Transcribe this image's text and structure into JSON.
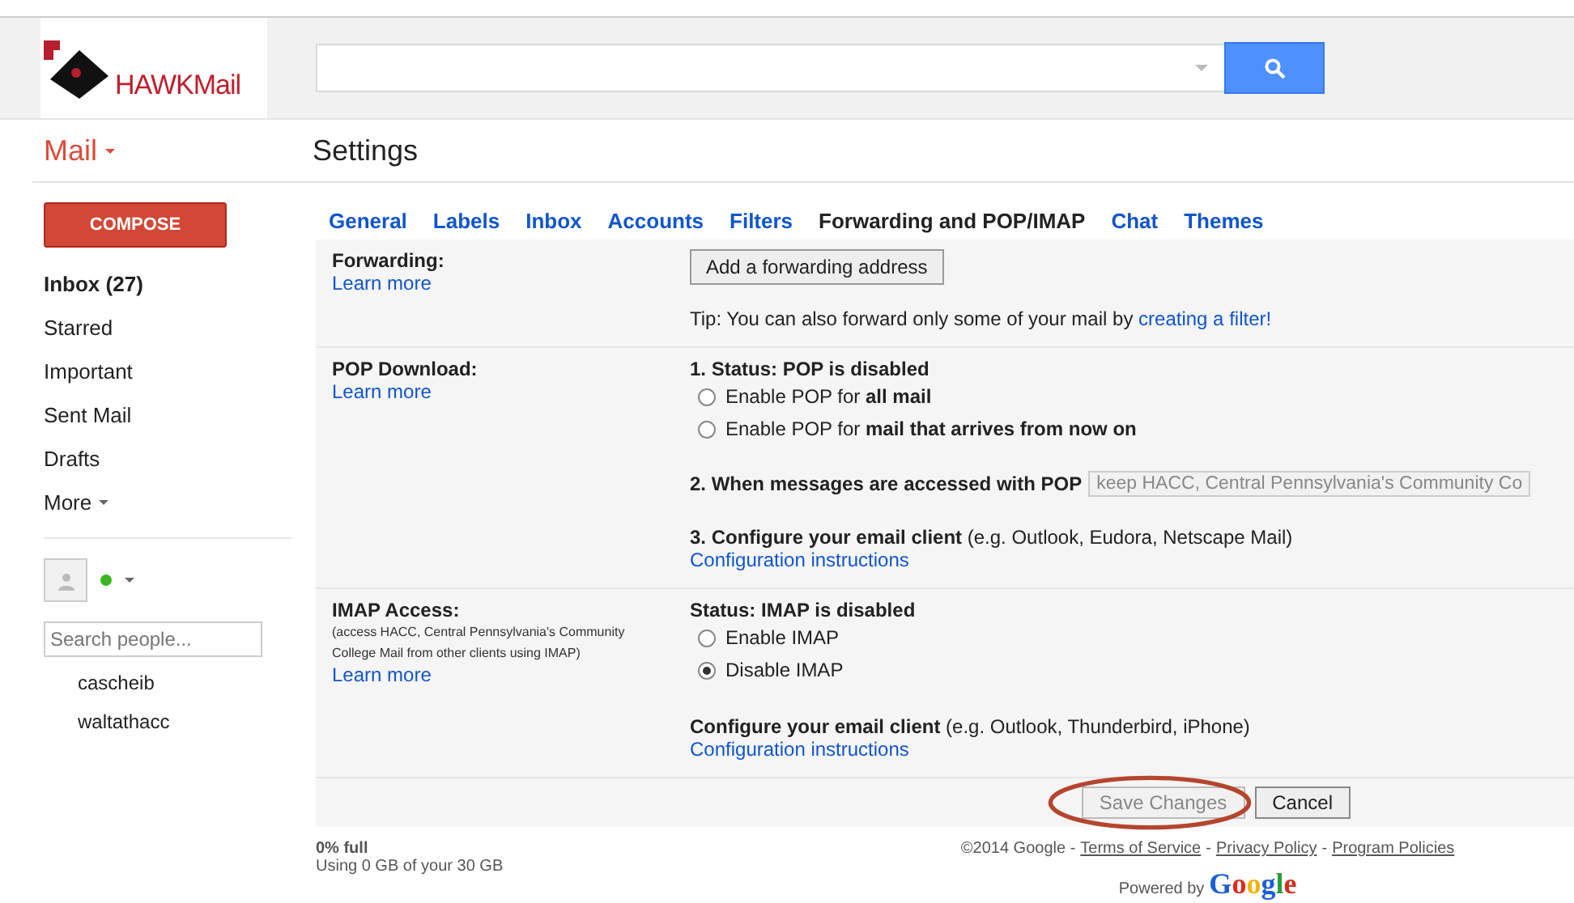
{
  "header": {
    "logo_text": "HAWKMail"
  },
  "app_switcher": "Mail",
  "page_title": "Settings",
  "compose": "COMPOSE",
  "nav": [
    {
      "label": "Inbox (27)",
      "selected": true
    },
    {
      "label": "Starred",
      "selected": false
    },
    {
      "label": "Important",
      "selected": false
    },
    {
      "label": "Sent Mail",
      "selected": false
    },
    {
      "label": "Drafts",
      "selected": false
    },
    {
      "label": "More",
      "selected": false,
      "kind": "menu"
    }
  ],
  "chat": {
    "online": true,
    "search": {
      "placeholder": "Search people..."
    },
    "contacts": [
      "cascheib",
      "waltathacc"
    ]
  },
  "tabs": [
    {
      "label": "General",
      "selected": false
    },
    {
      "label": "Labels",
      "selected": false
    },
    {
      "label": "Inbox",
      "selected": false
    },
    {
      "label": "Accounts",
      "selected": false
    },
    {
      "label": "Filters",
      "selected": false
    },
    {
      "label": "Forwarding and POP/IMAP",
      "selected": true
    },
    {
      "label": "Chat",
      "selected": false
    },
    {
      "label": "Themes",
      "selected": false
    }
  ],
  "sections": [
    {
      "title": "Forwarding:",
      "learn_more": "Learn more",
      "items": [
        {
          "kind": "button",
          "label": "Add a forwarding address"
        },
        {
          "kind": "tip",
          "text": "Tip: You can also forward only some of your mail by ",
          "link": "creating a filter!"
        }
      ]
    },
    {
      "title": "POP Download:",
      "learn_more": "Learn more",
      "items": [
        {
          "kind": "heading",
          "text": "**1. Status: POP is disabled**"
        },
        {
          "kind": "radio",
          "text": "Enable POP for **all mail**",
          "selected": false
        },
        {
          "kind": "radio",
          "text": "Enable POP for **mail that arrives from now on**",
          "selected": false
        },
        {
          "kind": "select",
          "text": "**2. When messages are accessed with POP**",
          "value": "keep HACC, Central Pennsylvania's Community Co"
        },
        {
          "kind": "config",
          "text": "**3. Configure your email client** (e.g. Outlook, Eudora, Netscape Mail)",
          "link": "Configuration instructions"
        }
      ]
    },
    {
      "title": "IMAP Access:",
      "note": "(access HACC, Central Pennsylvania's Community College Mail from other clients using IMAP)",
      "learn_more": "Learn more",
      "items": [
        {
          "kind": "heading",
          "text": "**Status: IMAP is disabled**"
        },
        {
          "kind": "radio",
          "text": "Enable IMAP",
          "selected": false
        },
        {
          "kind": "radio",
          "text": "Disable IMAP",
          "selected": true
        },
        {
          "kind": "config",
          "text": "**Configure your email client** (e.g. Outlook, Thunderbird, iPhone)",
          "link": "Configuration instructions"
        }
      ]
    }
  ],
  "actions": [
    {
      "label": "Save Changes",
      "disabled": true,
      "highlighted": true
    },
    {
      "label": "Cancel",
      "disabled": false,
      "highlighted": false
    }
  ],
  "footer": {
    "usage": "0% full",
    "usage_detail": "Using 0 GB of your 30 GB",
    "copyright": "©2014 Google -",
    "links": [
      {
        "label": "Terms of Service"
      },
      {
        "separator": "-",
        "label": "Privacy Policy"
      },
      {
        "separator": "-",
        "label": "Program Policies"
      }
    ],
    "powered_by": "Powered by",
    "google": "Google"
  }
}
